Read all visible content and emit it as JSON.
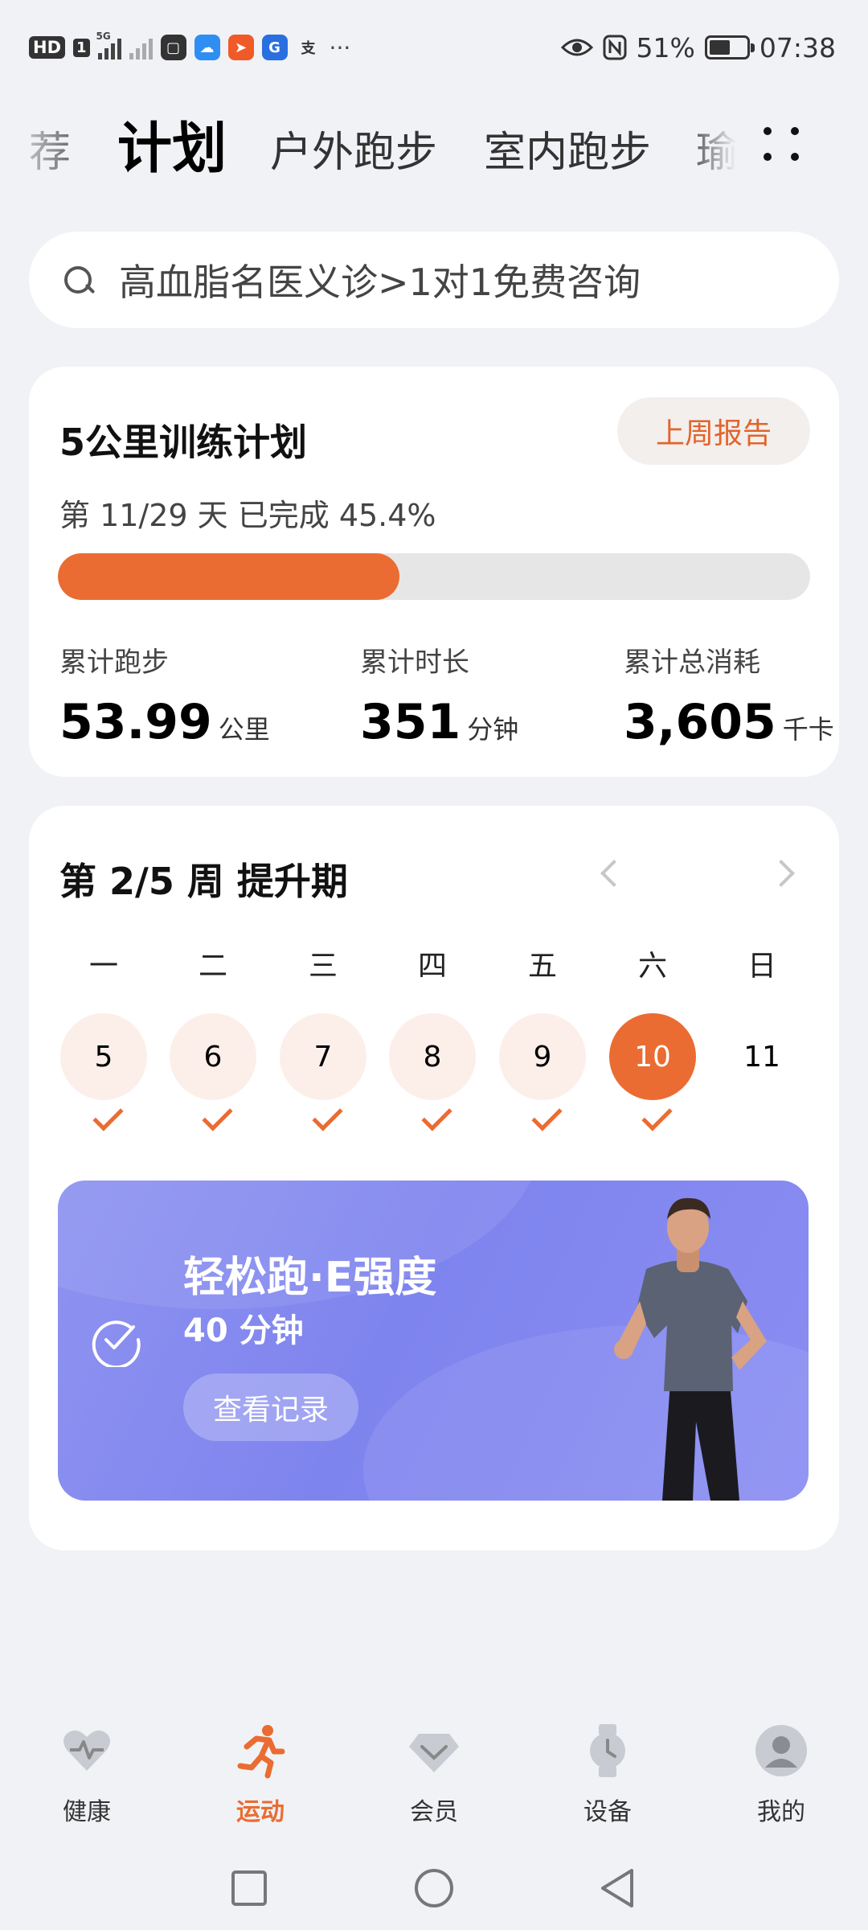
{
  "status_bar": {
    "hd": "HD",
    "sim": "1",
    "network": "5G",
    "more": "···",
    "battery": "51%",
    "time": "07:38",
    "apps": [
      {
        "icon": "bag-icon",
        "color": "#333333"
      },
      {
        "icon": "weather-icon",
        "color": "#2f8ef2"
      },
      {
        "icon": "paper-plane-icon",
        "color": "#f05a28"
      },
      {
        "icon": "g-app-icon",
        "color": "#2a6fe0"
      },
      {
        "icon": "alipay-icon",
        "color": "#333333"
      }
    ]
  },
  "tabs": {
    "items": [
      "荐",
      "计划",
      "户外跑步",
      "室内跑步",
      "瑜"
    ],
    "active_index": 1
  },
  "search": {
    "placeholder": "高血脂名医义诊>1对1免费咨询"
  },
  "plan": {
    "title": "5公里训练计划",
    "report_button": "上周报告",
    "progress_text": "第 11/29 天 已完成 45.4%",
    "progress_fraction": 0.454,
    "stats": [
      {
        "label": "累计跑步",
        "value": "53.99",
        "unit": "公里"
      },
      {
        "label": "累计时长",
        "value": "351",
        "unit": "分钟"
      },
      {
        "label": "累计总消耗",
        "value": "3,605",
        "unit": "千卡"
      }
    ]
  },
  "week": {
    "title": "第 2/5 周 提升期",
    "days": [
      {
        "label": "一",
        "date": "5",
        "done": true
      },
      {
        "label": "二",
        "date": "6",
        "done": true
      },
      {
        "label": "三",
        "date": "7",
        "done": true
      },
      {
        "label": "四",
        "date": "8",
        "done": true
      },
      {
        "label": "五",
        "date": "9",
        "done": true
      },
      {
        "label": "六",
        "date": "10",
        "done": true,
        "today": true
      },
      {
        "label": "日",
        "date": "11",
        "done": false
      }
    ]
  },
  "workout": {
    "title": "轻松跑·E强度",
    "duration": "40 分钟",
    "record_button": "查看记录",
    "accent": "#8287ef"
  },
  "bottom_nav": [
    {
      "label": "健康",
      "icon": "heart-pulse-icon"
    },
    {
      "label": "运动",
      "icon": "runner-icon",
      "active": true
    },
    {
      "label": "会员",
      "icon": "diamond-icon"
    },
    {
      "label": "设备",
      "icon": "watch-icon"
    },
    {
      "label": "我的",
      "icon": "profile-icon"
    }
  ],
  "colors": {
    "accent": "#ea6c32",
    "background": "#f1f2f6",
    "card": "#ffffff"
  }
}
